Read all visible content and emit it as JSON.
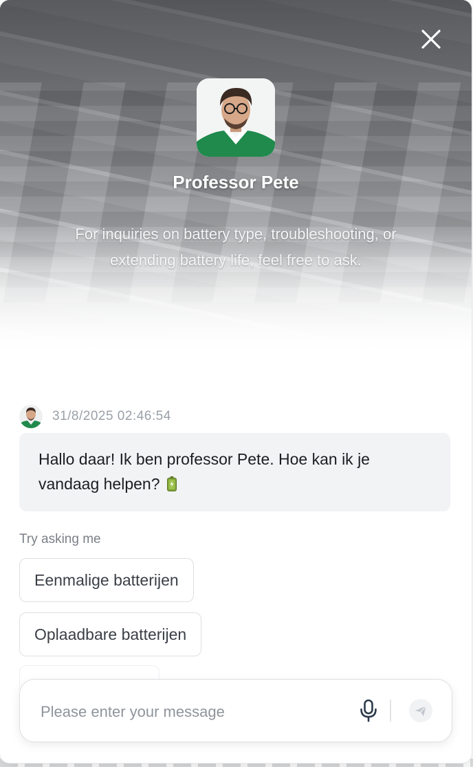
{
  "header": {
    "agent_name": "Professor Pete",
    "description": "For inquiries on battery type, troubleshooting, or extending battery life, feel free to ask.",
    "close_icon": "close-icon"
  },
  "messages": [
    {
      "timestamp": "31/8/2025 02:46:54",
      "text": "Hallo daar! Ik ben professor Pete. Hoe kan ik je vandaag helpen?",
      "emoji": "battery-icon"
    }
  ],
  "suggestions": {
    "label": "Try asking me",
    "items": [
      "Eenmalige batterijen",
      "Oplaadbare batterijen"
    ]
  },
  "composer": {
    "placeholder": "Please enter your message",
    "mic_icon": "microphone-icon",
    "send_icon": "send-icon"
  },
  "colors": {
    "bubble_bg": "#f2f3f5",
    "chip_border": "#dcdfe3",
    "timestamp": "#9aa0a8"
  }
}
